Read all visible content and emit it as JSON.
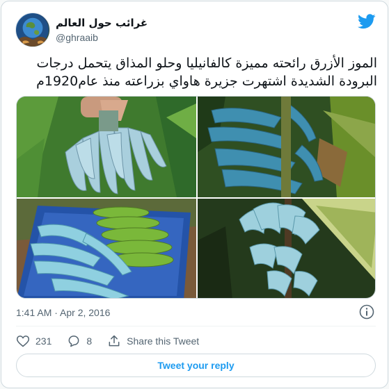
{
  "author": {
    "display_name": "غرائب حول العالم",
    "handle": "@ghraaib",
    "avatar_icon": "globe-avatar"
  },
  "brand": {
    "logo_icon": "twitter-bird-icon",
    "color": "#1d9bf0"
  },
  "tweet": {
    "text_line_1": "الموز الأزرق رائحته مميزة كالفانيليا وحلو المذاق يتحمل درجات",
    "text_line_2": "البرودة الشديدة اشتهرت جزيرة هاواي بزراعته منذ عام1920م",
    "timestamp": "1:41 AM · Apr 2, 2016"
  },
  "media": {
    "photos": [
      {
        "subject": "blue-banana-bunch-in-hand"
      },
      {
        "subject": "blue-banana-bunch-on-tree"
      },
      {
        "subject": "blue-and-green-bananas-in-wheelbarrow"
      },
      {
        "subject": "blue-banana-bunch-with-leaves"
      }
    ]
  },
  "actions": {
    "like_count": "231",
    "reply_count": "8",
    "share_label": "Share this Tweet"
  },
  "reply_button_label": "Tweet your reply",
  "colors": {
    "secondary_text": "#536471",
    "border": "#cfd9de",
    "banana_blue": "#8fc3d6"
  }
}
